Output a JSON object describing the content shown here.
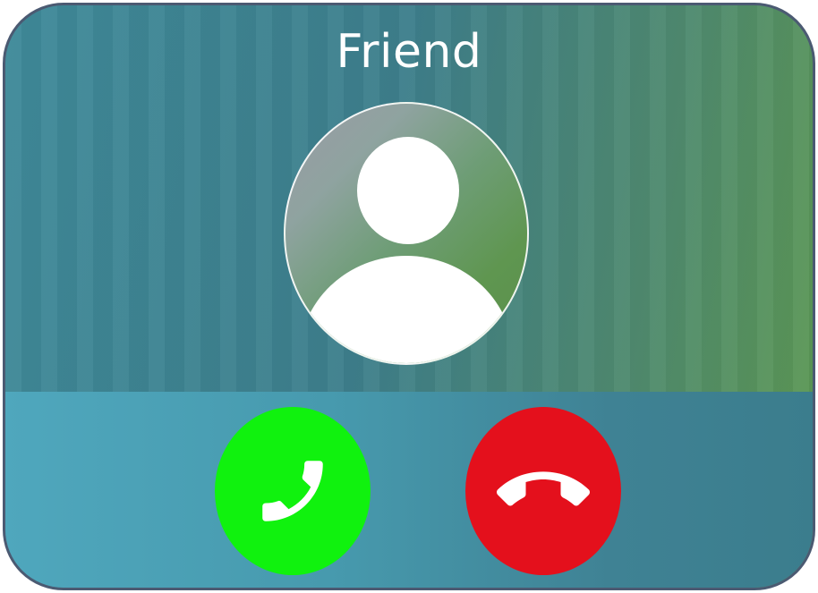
{
  "caller": {
    "name": "Friend"
  },
  "avatar": {
    "icon": "user-silhouette-icon"
  },
  "actions": {
    "accept": {
      "icon": "phone-handset-icon",
      "color": "#10f20e"
    },
    "decline": {
      "icon": "phone-hangup-icon",
      "color": "#e4101c"
    }
  },
  "colors": {
    "background_left": "#3f8a9a",
    "background_right": "#5e9a52",
    "panel": "#479aae",
    "frame_border": "#4b5a72"
  }
}
